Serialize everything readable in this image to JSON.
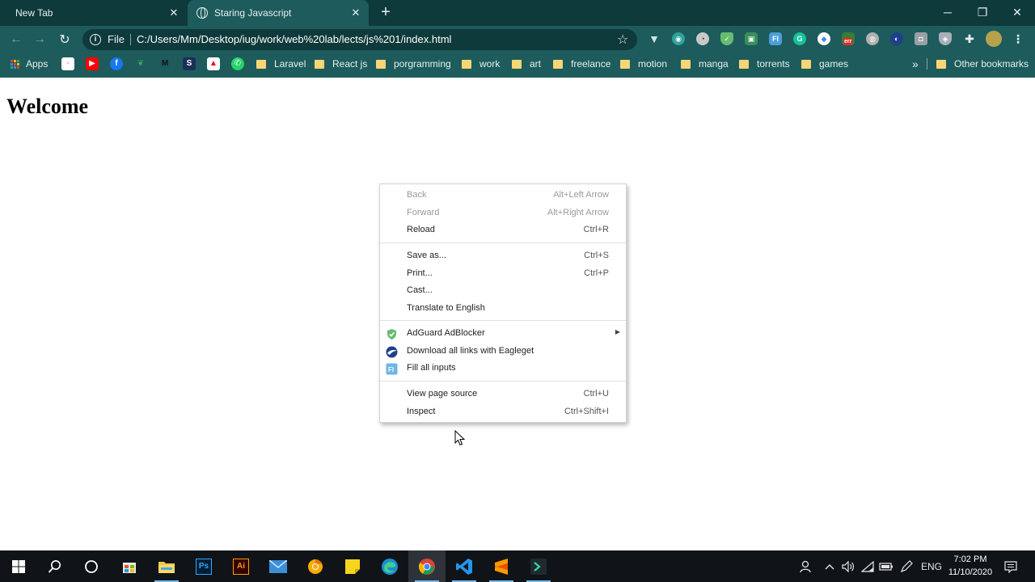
{
  "browser": {
    "tabs": [
      {
        "title": "New Tab",
        "active": false
      },
      {
        "title": "Staring Javascript",
        "active": true
      }
    ],
    "window_controls": [
      "minimize",
      "restore",
      "close"
    ],
    "address_bar": {
      "scheme_label": "File",
      "url": "C:/Users/Mm/Desktop/iug/work/web%20lab/lects/js%201/index.html"
    },
    "extensions": [
      "vue-devtools-icon",
      "eye-extension-icon",
      "gauge-extension-icon",
      "adguard-icon",
      "image-extension-icon",
      "fill-all-inputs-icon",
      "grammarly-icon",
      "google-icon",
      "html-extension-icon",
      "globe-extension-icon",
      "eagleget-icon",
      "camera-extension-icon",
      "shield-extension-icon",
      "extensions-puzzle-icon",
      "profile-avatar",
      "chrome-menu-icon"
    ],
    "extension_badge": "err",
    "bookmarks": {
      "apps_label": "Apps",
      "folders": [
        "Laravel",
        "React js",
        "porgramming",
        "work",
        "art",
        "freelance",
        "motion",
        "manga",
        "torrents",
        "games"
      ],
      "overflow": "»",
      "other_label": "Other bookmarks"
    }
  },
  "page": {
    "heading": "Welcome"
  },
  "context_menu": {
    "groups": [
      [
        {
          "label": "Back",
          "shortcut": "Alt+Left Arrow",
          "disabled": true
        },
        {
          "label": "Forward",
          "shortcut": "Alt+Right Arrow",
          "disabled": true
        },
        {
          "label": "Reload",
          "shortcut": "Ctrl+R",
          "disabled": false
        }
      ],
      [
        {
          "label": "Save as...",
          "shortcut": "Ctrl+S"
        },
        {
          "label": "Print...",
          "shortcut": "Ctrl+P"
        },
        {
          "label": "Cast...",
          "shortcut": ""
        },
        {
          "label": "Translate to English",
          "shortcut": ""
        }
      ],
      [
        {
          "label": "AdGuard AdBlocker",
          "icon": "adguard-icon",
          "submenu": true
        },
        {
          "label": "Download all links with Eagleget",
          "icon": "eagleget-icon"
        },
        {
          "label": "Fill all inputs",
          "icon": "fill-all-inputs-icon"
        }
      ],
      [
        {
          "label": "View page source",
          "shortcut": "Ctrl+U"
        },
        {
          "label": "Inspect",
          "shortcut": "Ctrl+Shift+I"
        }
      ]
    ]
  },
  "taskbar": {
    "apps": [
      "windows-start-icon",
      "search-icon",
      "cortana-icon",
      "store-icon",
      "file-explorer-icon",
      "photoshop-icon",
      "illustrator-icon",
      "mail-icon",
      "chrome-canary-icon",
      "sticky-notes-icon",
      "edge-icon",
      "chrome-icon",
      "vscode-icon",
      "sublime-text-icon",
      "terminal-app-icon"
    ],
    "photoshop_label": "Ps",
    "illustrator_label": "Ai",
    "language": "ENG",
    "time": "7:02 PM",
    "date": "11/10/2020"
  },
  "colors": {
    "tabstrip": "#0e3a3b",
    "toolbar": "#1d5b5c",
    "taskbar": "#101418"
  }
}
